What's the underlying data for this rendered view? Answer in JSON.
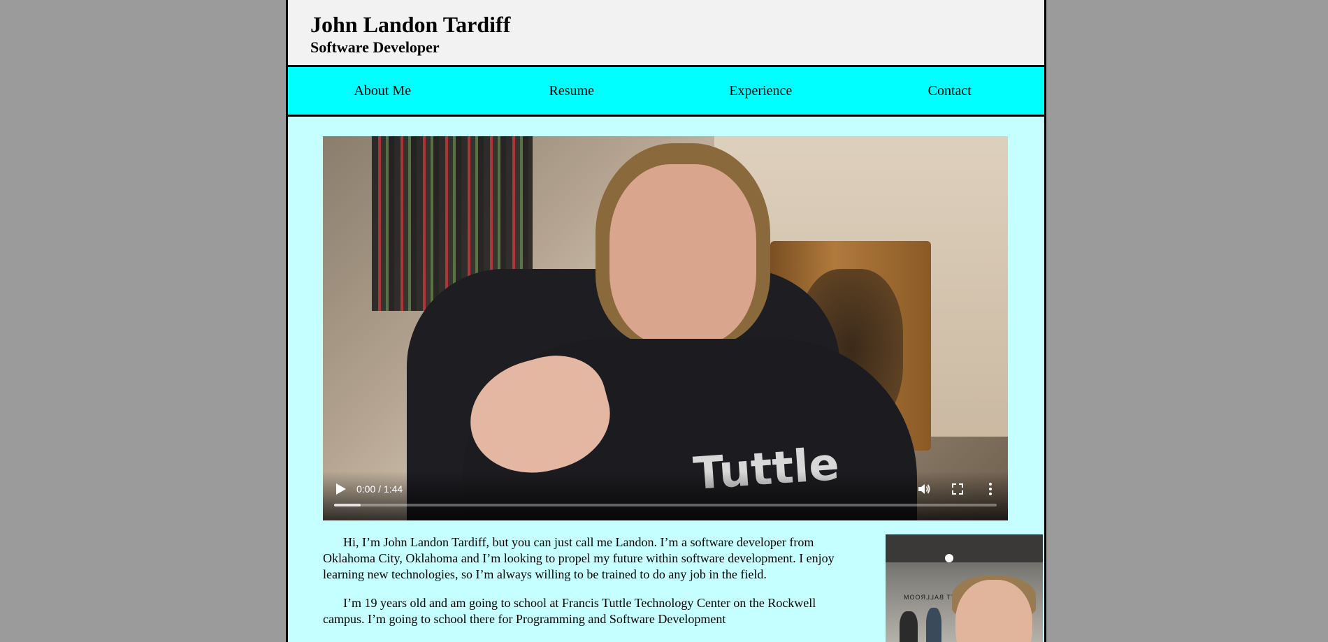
{
  "header": {
    "name": "John Landon Tardiff",
    "role": "Software Developer"
  },
  "nav": {
    "items": [
      {
        "label": "About Me"
      },
      {
        "label": "Resume"
      },
      {
        "label": "Experience"
      },
      {
        "label": "Contact"
      }
    ]
  },
  "video": {
    "time": "0:00 / 1:44",
    "shirt_text": "Tuttle",
    "icons": [
      "play-icon",
      "volume-icon",
      "fullscreen-icon",
      "more-options-icon"
    ]
  },
  "about": {
    "paragraphs": [
      "Hi, I’m John Landon Tardiff, but you can just call me Landon. I’m a software developer from Oklahoma City, Oklahoma and I’m looking to propel my future within software development. I enjoy learning new technologies, so I’m always willing to be trained to do any job in the field.",
      "I’m 19 years old and am going to school at Francis Tuttle Technology Center on the Rockwell campus. I’m going to school there for Programming and Software Development"
    ],
    "photo_sign": "MOORE TT BALLROOM"
  },
  "colors": {
    "background": "#9b9b9b",
    "header_bg": "#f2f2f2",
    "nav_bg": "#00ffff",
    "content_bg": "#c6ffff"
  }
}
